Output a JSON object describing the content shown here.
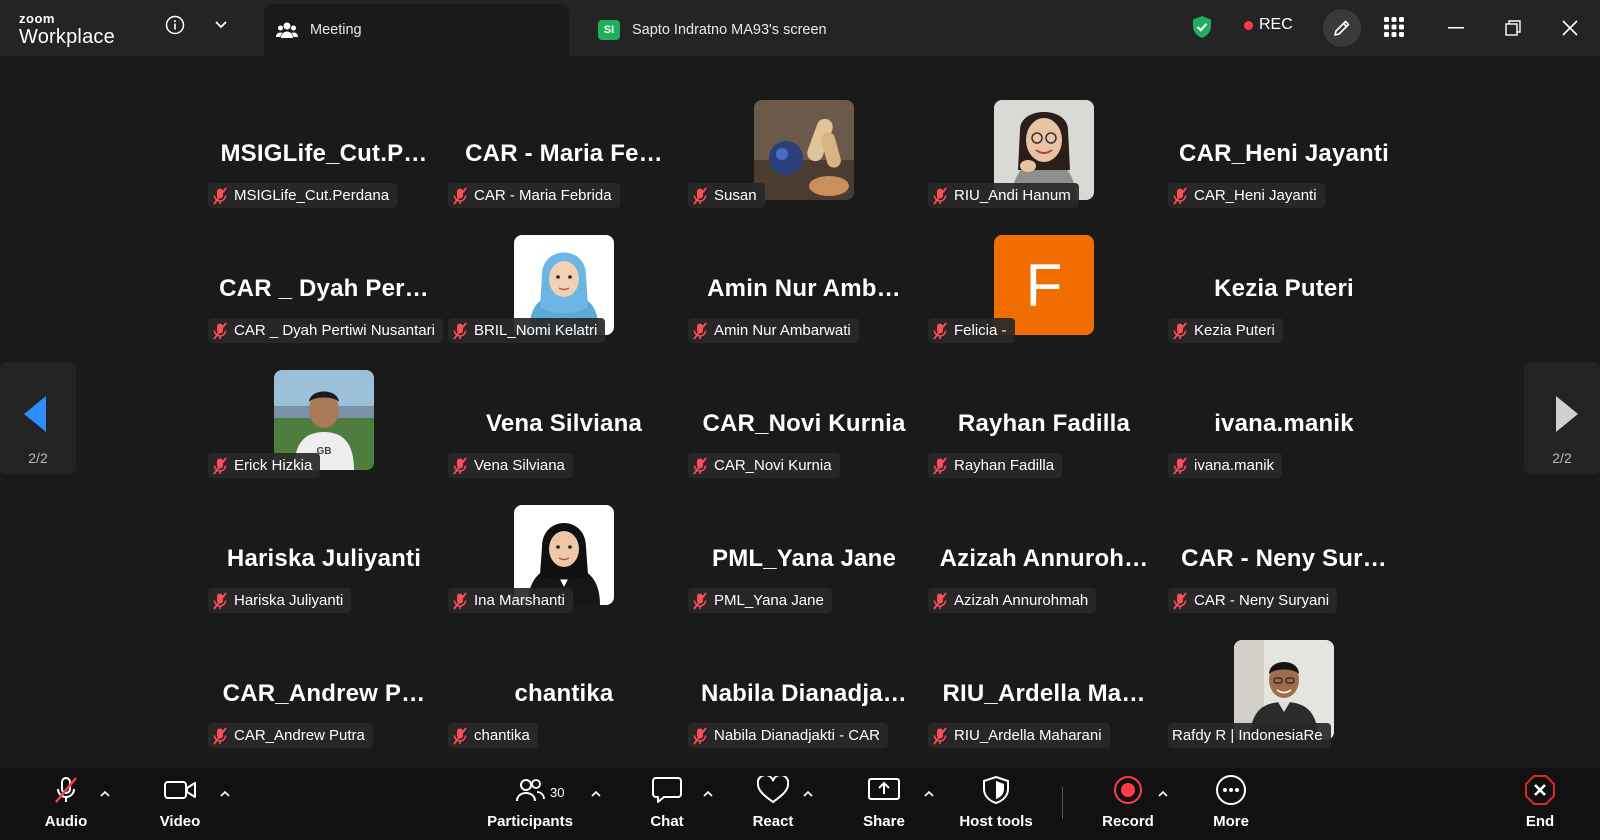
{
  "app": {
    "brand_small": "zoom",
    "brand_large": "Workplace"
  },
  "tabs": [
    {
      "label": "Meeting",
      "icon": "people-icon"
    },
    {
      "label": "Sapto Indratno MA93's screen",
      "badge": "SI"
    }
  ],
  "rec_label": "REC",
  "pager": {
    "left": "2/2",
    "right": "2/2"
  },
  "participants": [
    {
      "big": "MSIGLife_Cut.P…",
      "name": "MSIGLife_Cut.Perdana"
    },
    {
      "big": "CAR - Maria Fe…",
      "name": "CAR - Maria Febrida"
    },
    {
      "avatar": "photo-hands",
      "name": "Susan"
    },
    {
      "avatar": "photo-woman-glasses",
      "name": "RIU_Andi Hanum"
    },
    {
      "big": "CAR_Heni Jayanti",
      "name": "CAR_Heni Jayanti"
    },
    {
      "big": "CAR _ Dyah Per…",
      "name": "CAR _ Dyah Pertiwi Nusantari"
    },
    {
      "avatar": "photo-hijab-blue",
      "name": "BRIL_Nomi Kelatri"
    },
    {
      "big": "Amin Nur Amb…",
      "name": "Amin Nur Ambarwati"
    },
    {
      "avatar": "letter-f",
      "letter": "F",
      "name": "Felicia -"
    },
    {
      "big": "Kezia Puteri",
      "name": "Kezia Puteri"
    },
    {
      "avatar": "photo-man-outdoor",
      "name": "Erick Hizkia"
    },
    {
      "big": "Vena Silviana",
      "name": "Vena Silviana"
    },
    {
      "big": "CAR_Novi Kurnia",
      "name": "CAR_Novi Kurnia"
    },
    {
      "big": "Rayhan Fadilla",
      "name": "Rayhan Fadilla"
    },
    {
      "big": "ivana.manik",
      "name": "ivana.manik"
    },
    {
      "big": "Hariska Juliyanti",
      "name": "Hariska Juliyanti"
    },
    {
      "avatar": "photo-hijab-black",
      "name": "Ina Marshanti"
    },
    {
      "big": "PML_Yana Jane",
      "name": "PML_Yana Jane"
    },
    {
      "big": "Azizah Annuroh…",
      "name": "Azizah Annurohmah"
    },
    {
      "big": "CAR - Neny Sur…",
      "name": "CAR - Neny Suryani"
    },
    {
      "big": "CAR_Andrew P…",
      "name": "CAR_Andrew Putra"
    },
    {
      "big": "chantika",
      "name": "chantika"
    },
    {
      "big": "Nabila Dianadja…",
      "name": "Nabila Dianadjakti - CAR"
    },
    {
      "big": "RIU_Ardella Ma…",
      "name": "RIU_Ardella Maharani"
    },
    {
      "avatar": "photo-man-office",
      "name": "Rafdy R | IndonesiaRe",
      "unmuted": true
    }
  ],
  "toolbar": {
    "audio": "Audio",
    "video": "Video",
    "participants": "Participants",
    "participants_count": "30",
    "chat": "Chat",
    "react": "React",
    "share": "Share",
    "host_tools": "Host tools",
    "record": "Record",
    "more": "More",
    "end": "End"
  },
  "colors": {
    "accent": "#2d8cff",
    "record": "#ff3b4a",
    "shield": "#1fae5b",
    "felicia_orange": "#f26d00",
    "end": "#e02828"
  }
}
